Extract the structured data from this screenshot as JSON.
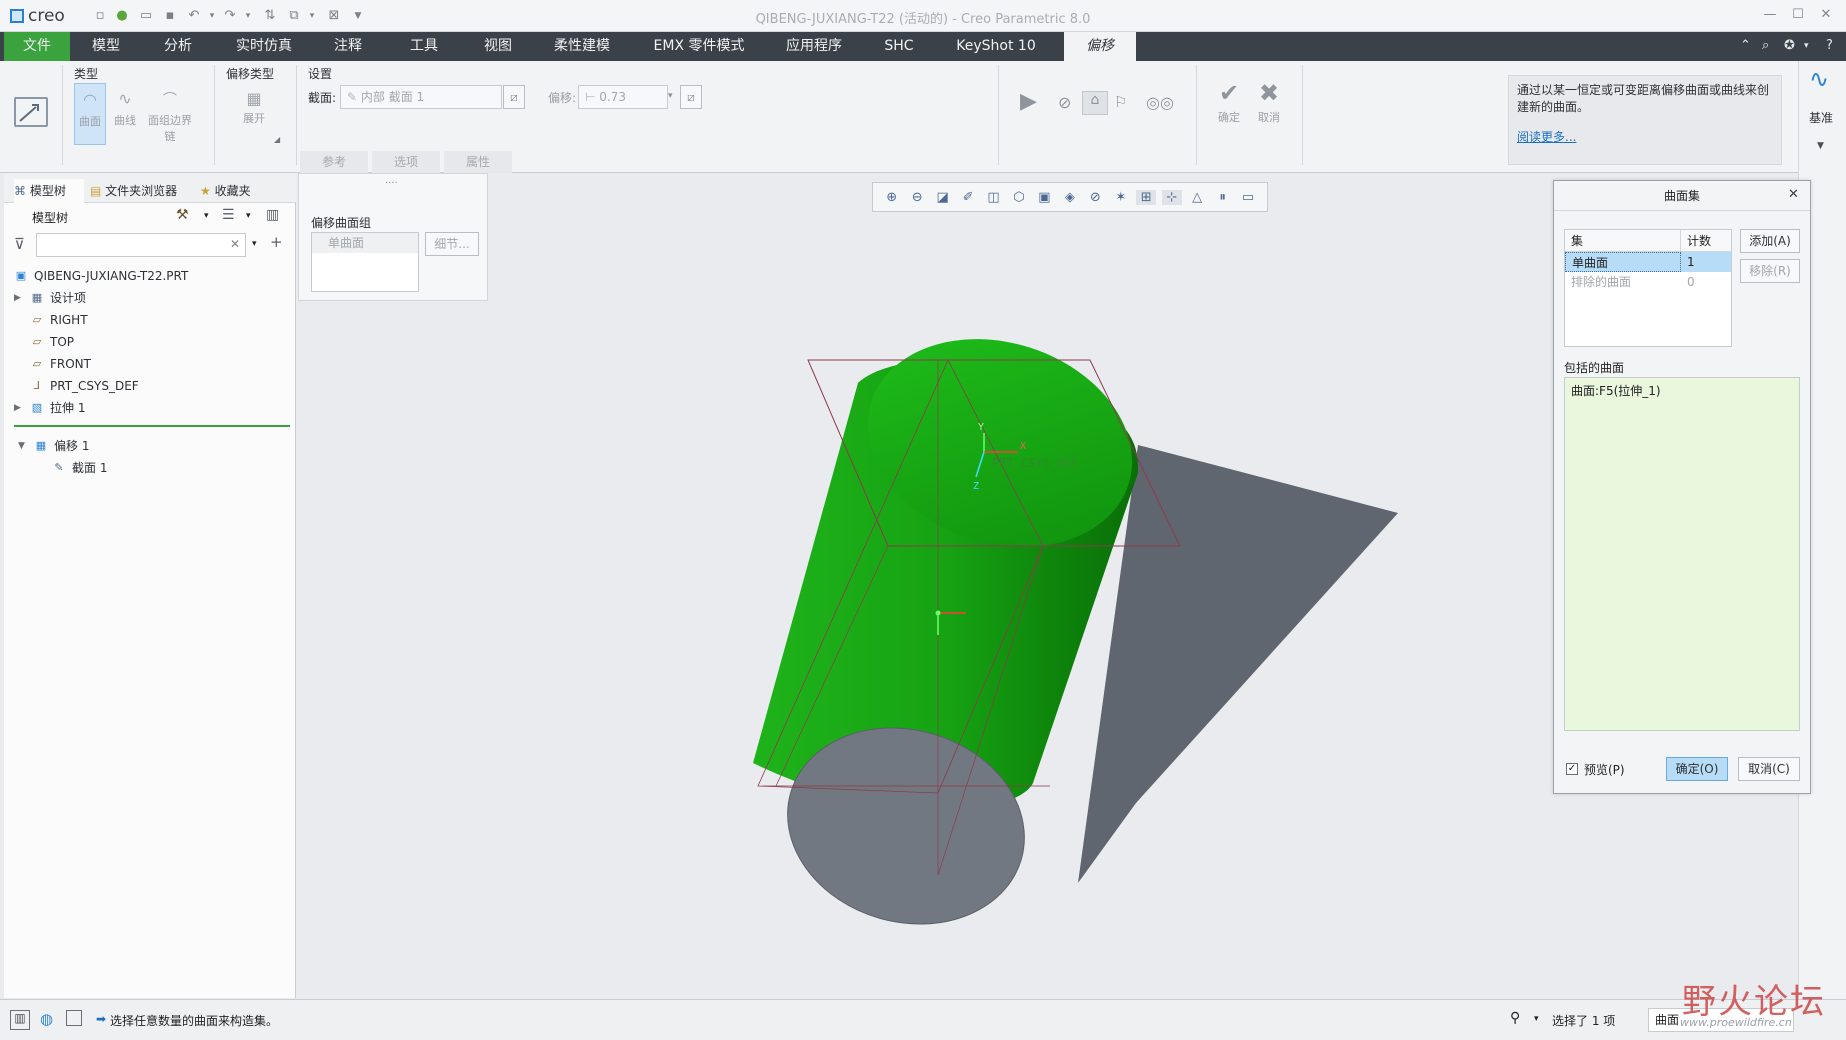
{
  "app": {
    "logo_text": "creo",
    "window_title": "QIBENG-JUXIANG-T22 (活动的) - Creo Parametric 8.0"
  },
  "tabs": [
    {
      "label": "文件"
    },
    {
      "label": "模型"
    },
    {
      "label": "分析"
    },
    {
      "label": "实时仿真"
    },
    {
      "label": "注释"
    },
    {
      "label": "工具"
    },
    {
      "label": "视图"
    },
    {
      "label": "柔性建模"
    },
    {
      "label": "EMX 零件模式"
    },
    {
      "label": "应用程序"
    },
    {
      "label": "SHC"
    },
    {
      "label": "KeyShot 10"
    },
    {
      "label": "偏移"
    }
  ],
  "ribbon": {
    "type_group": "类型",
    "type_options": [
      "曲面",
      "曲线",
      "面组边界链"
    ],
    "offset_type_group": "偏移类型",
    "offset_type_option": "展开",
    "settings_group": "设置",
    "section_label": "截面:",
    "section_value": "内部 截面 1",
    "offset_label": "偏移:",
    "offset_value": "0.73",
    "ok_label": "确定",
    "cancel_label": "取消",
    "subtabs": [
      "参考",
      "选项",
      "属性"
    ],
    "info_text": "通过以某一恒定或可变距离偏移曲面或曲线来创建新的曲面。",
    "info_link": "阅读更多...",
    "datum_label": "基准"
  },
  "left_panel": {
    "tabs": [
      "模型树",
      "文件夹浏览器",
      "收藏夹"
    ],
    "tree_header": "模型树",
    "tree_items": [
      {
        "label": "QIBENG-JUXIANG-T22.PRT",
        "icon": "part-icon"
      },
      {
        "label": "设计项",
        "icon": "design-items-icon",
        "expander": "▶"
      },
      {
        "label": "RIGHT",
        "icon": "datum-plane-icon"
      },
      {
        "label": "TOP",
        "icon": "datum-plane-icon"
      },
      {
        "label": "FRONT",
        "icon": "datum-plane-icon"
      },
      {
        "label": "PRT_CSYS_DEF",
        "icon": "csys-icon"
      },
      {
        "label": "拉伸 1",
        "icon": "extrude-icon",
        "expander": "▶"
      }
    ],
    "insert_items": [
      {
        "label": "偏移 1",
        "icon": "offset-icon",
        "expander": "▼"
      },
      {
        "label": "截面 1",
        "icon": "sketch-icon"
      }
    ]
  },
  "popup_panel": {
    "title": "偏移曲面组",
    "item": "单曲面",
    "detail_button": "细节..."
  },
  "dialog": {
    "title": "曲面集",
    "col_set": "集",
    "col_count": "计数",
    "rows": [
      {
        "name": "单曲面",
        "count": "1"
      },
      {
        "name": "排除的曲面",
        "count": "0"
      }
    ],
    "add_button": "添加(A)",
    "remove_button": "移除(R)",
    "included_label": "包括的曲面",
    "included_items": [
      "曲面:F5(拉伸_1)"
    ],
    "preview_label": "预览(P)",
    "ok_button": "确定(O)",
    "cancel_button": "取消(C)"
  },
  "graphics": {
    "csys_label": "PRT_CSYS_DEF",
    "axis_x": "X",
    "axis_y": "Y",
    "axis_z": "Z"
  },
  "status": {
    "message": "选择任意数量的曲面来构造集。",
    "selection": "选择了 1 项",
    "filter": "曲面",
    "watermark": "野火论坛",
    "watermark_url": "www.proewildfire.cn"
  },
  "colors": {
    "accent_green": "#3aa33d",
    "cylinder_green": "#1fa31a",
    "tab_bar": "#3b4148",
    "dialog_list_bg": "#e9f7dc"
  }
}
